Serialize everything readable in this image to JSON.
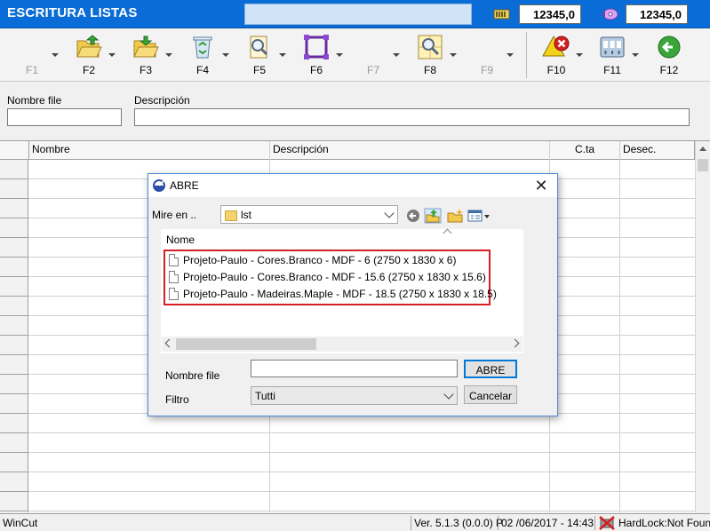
{
  "window": {
    "title": "ESCRITURA LISTAS"
  },
  "counters": [
    {
      "icon": "battery-icon",
      "value": "12345,0"
    },
    {
      "icon": "disc-icon",
      "value": "12345,0"
    }
  ],
  "toolbar": {
    "buttons": [
      {
        "key": "F1",
        "icon": "",
        "enabled": false
      },
      {
        "key": "F2",
        "icon": "folder-open-icon",
        "enabled": true
      },
      {
        "key": "F3",
        "icon": "folder-import-icon",
        "enabled": true
      },
      {
        "key": "F4",
        "icon": "recycle-bin-icon",
        "enabled": true
      },
      {
        "key": "F5",
        "icon": "search-document-icon",
        "enabled": true
      },
      {
        "key": "F6",
        "icon": "frame-icon",
        "enabled": true
      },
      {
        "key": "F7",
        "icon": "",
        "enabled": false
      },
      {
        "key": "F8",
        "icon": "zoom-icon",
        "enabled": true
      },
      {
        "key": "F9",
        "icon": "",
        "enabled": false
      },
      {
        "key": "F10",
        "icon": "warning-close-icon",
        "enabled": true
      },
      {
        "key": "F11",
        "icon": "network-icon",
        "enabled": true
      },
      {
        "key": "F12",
        "icon": "back-arrow-icon",
        "enabled": true
      }
    ]
  },
  "form": {
    "file_name_label": "Nombre file",
    "file_name_value": "",
    "description_label": "Descripción",
    "description_value": ""
  },
  "grid": {
    "columns": [
      "Nombre",
      "Descripción",
      "C.ta",
      "Desec."
    ]
  },
  "status": {
    "app": "WinCut",
    "version": "Ver. 5.1.3 (0.0.0) P",
    "datetime": "02 /06/2017  -  14:43",
    "hardlock": "HardLock:Not Found"
  },
  "dialog": {
    "title": "ABRE",
    "look_in_label": "Mire en ..",
    "look_in_value": "lst",
    "list_header": "Nome",
    "files": [
      "Projeto-Paulo - Cores.Branco - MDF - 6 (2750 x 1830 x 6)",
      "Projeto-Paulo - Cores.Branco - MDF - 15.6 (2750 x 1830 x 15.6)",
      "Projeto-Paulo - Madeiras.Maple - MDF - 18.5 (2750 x 1830 x 18.5)"
    ],
    "file_name_label": "Nombre file",
    "file_name_value": "",
    "filter_label": "Filtro",
    "filter_value": "Tutti",
    "open_button": "ABRE",
    "cancel_button": "Cancelar"
  },
  "colors": {
    "titlebar": "#0a6cd6",
    "highlight": "#d71f26",
    "dialog_border": "#4a8ad6"
  }
}
